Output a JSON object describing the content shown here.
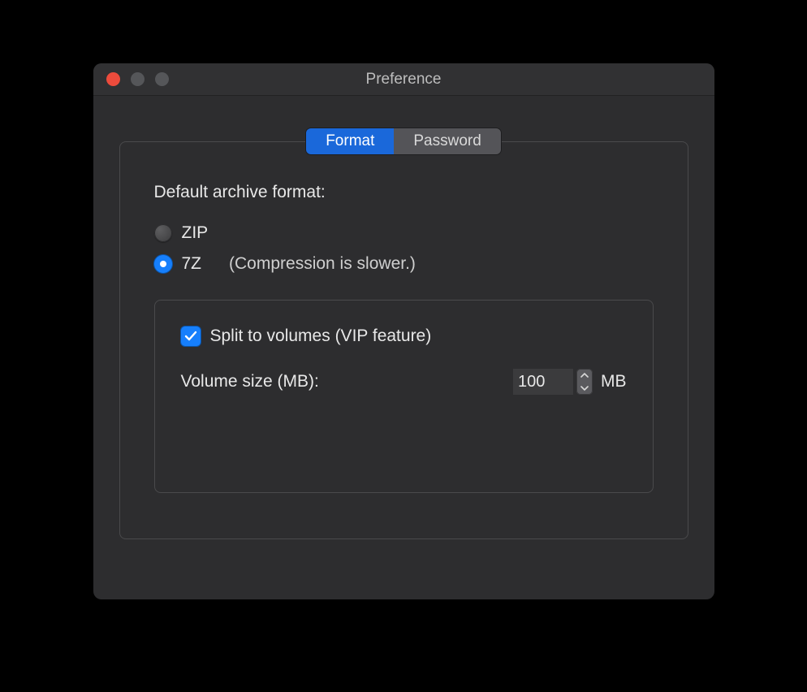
{
  "window": {
    "title": "Preference"
  },
  "tabs": {
    "format": "Format",
    "password": "Password",
    "active": "format"
  },
  "format_panel": {
    "default_label": "Default archive format:",
    "options": {
      "zip": {
        "label": "ZIP",
        "selected": false
      },
      "sevenz": {
        "label": "7Z",
        "selected": true,
        "note": "(Compression is slower.)"
      }
    },
    "split": {
      "enabled": true,
      "label": "Split to volumes (VIP feature)",
      "size_label": "Volume size (MB):",
      "size_value": "100",
      "unit": "MB"
    }
  }
}
